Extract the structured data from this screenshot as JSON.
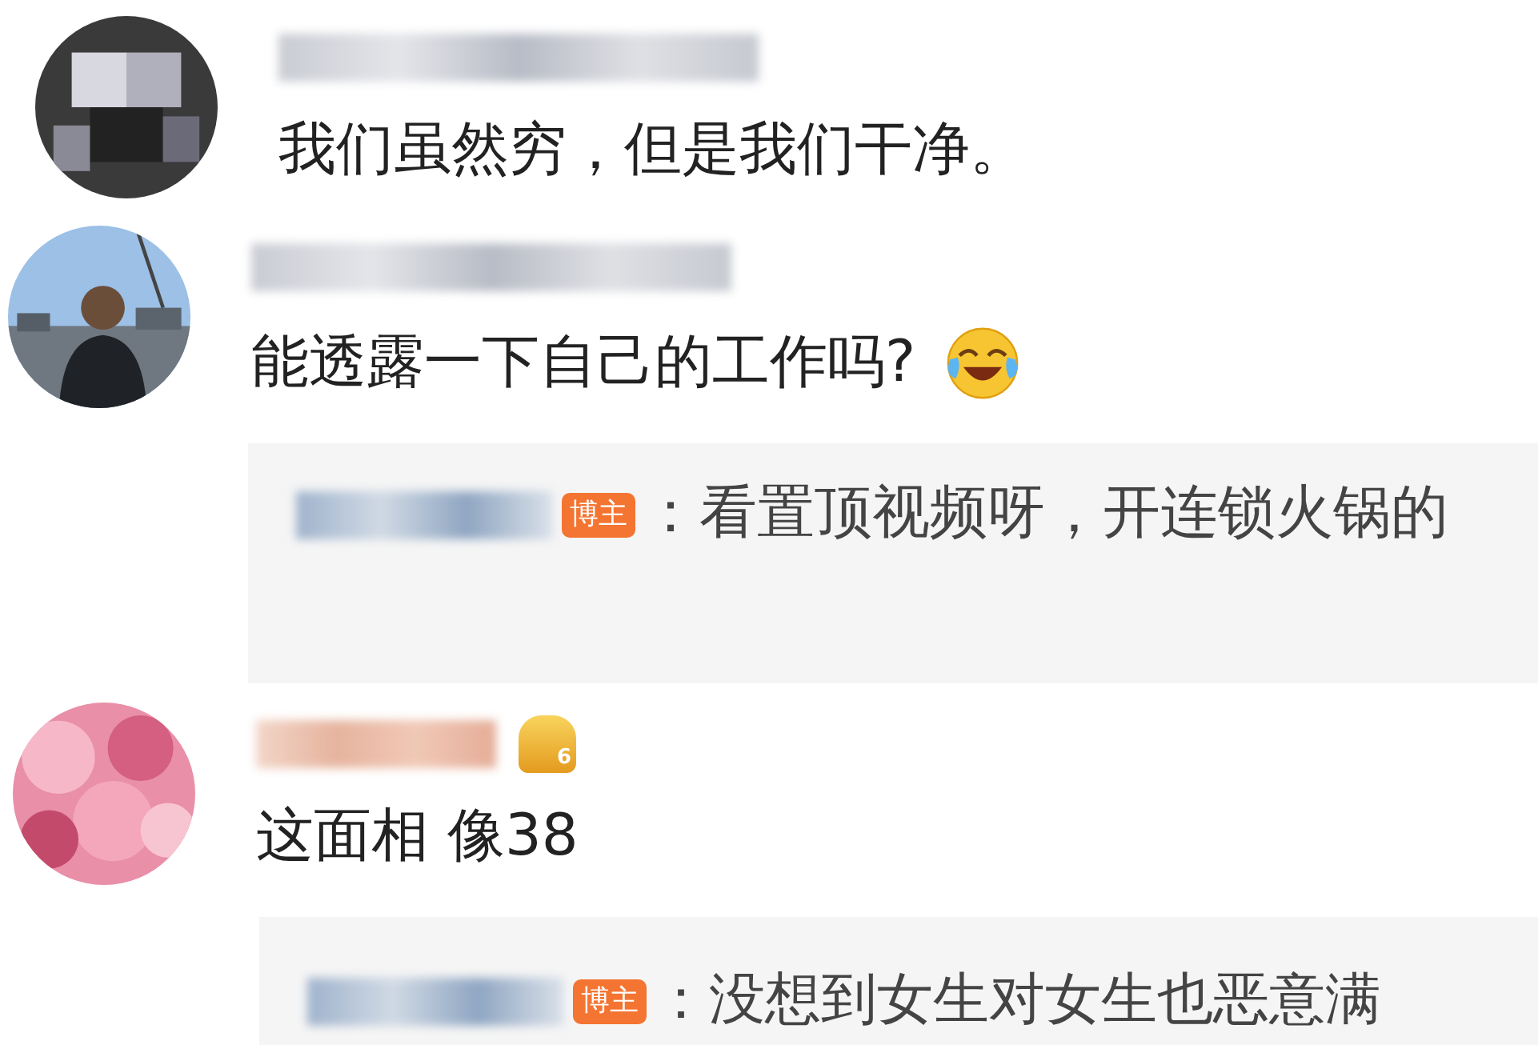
{
  "comments": [
    {
      "text": "我们虽然穷，但是我们干净。"
    },
    {
      "text": "能透露一下自己的工作吗?",
      "emoji": {
        "kind": "laughing"
      },
      "reply": {
        "badge": "博主",
        "text": "：看置顶视频呀，开连锁火锅的"
      }
    },
    {
      "text": "这面相 像38",
      "vip_level": "6",
      "reply": {
        "badge": "博主",
        "text": "：没想到女生对女生也恶意满"
      }
    }
  ]
}
